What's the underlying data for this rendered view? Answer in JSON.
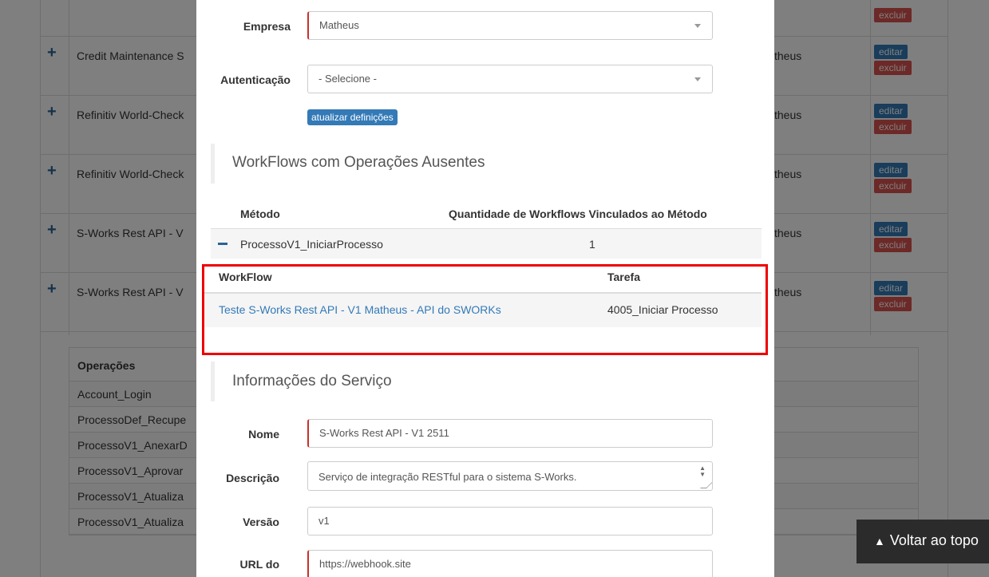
{
  "background": {
    "rows": [
      {
        "name": "Credit Maintenance S",
        "owner": "theus",
        "edit": "editar",
        "delete": "excluir"
      },
      {
        "name": "Refinitiv World-Check",
        "owner": "theus",
        "edit": "editar",
        "delete": "excluir"
      },
      {
        "name": "Refinitiv World-Check",
        "owner": "theus",
        "edit": "editar",
        "delete": "excluir"
      },
      {
        "name": "S-Works Rest API - V",
        "owner": "theus",
        "edit": "editar",
        "delete": "excluir"
      },
      {
        "name": "S-Works Rest API - V",
        "owner": "theus",
        "edit": "editar",
        "delete": "excluir"
      }
    ],
    "top_delete": "excluir",
    "operations": {
      "header": "Operações",
      "items": [
        "Account_Login",
        "ProcessoDef_Recupe",
        "ProcessoV1_AnexarD",
        "ProcessoV1_Aprovar",
        "ProcessoV1_Atualiza",
        "ProcessoV1_Atualiza"
      ]
    },
    "back_to_top": "Voltar ao topo"
  },
  "modal": {
    "empresa": {
      "label": "Empresa",
      "value": "Matheus"
    },
    "autenticacao": {
      "label": "Autenticação",
      "value": "- Selecione -"
    },
    "update_button": "atualizar definições",
    "missing_section_title": "WorkFlows com Operações Ausentes",
    "methods_table": {
      "col_method": "Método",
      "col_count": "Quantidade de Workflows Vinculados ao Método",
      "row": {
        "method": "ProcessoV1_IniciarProcesso",
        "count": "1"
      }
    },
    "workflow_table": {
      "col_workflow": "WorkFlow",
      "col_task": "Tarefa",
      "row": {
        "workflow": "Teste S-Works Rest API - V1 Matheus - API do SWORKs",
        "task": "4005_Iniciar Processo"
      }
    },
    "service_section_title": "Informações do Serviço",
    "nome": {
      "label": "Nome",
      "value": "S-Works Rest API - V1 2511"
    },
    "descricao": {
      "label": "Descrição",
      "value": "Serviço de integração RESTful para o sistema S-Works."
    },
    "versao": {
      "label": "Versão",
      "value": "v1"
    },
    "url": {
      "label": "URL do",
      "value": "https://webhook.site"
    }
  }
}
